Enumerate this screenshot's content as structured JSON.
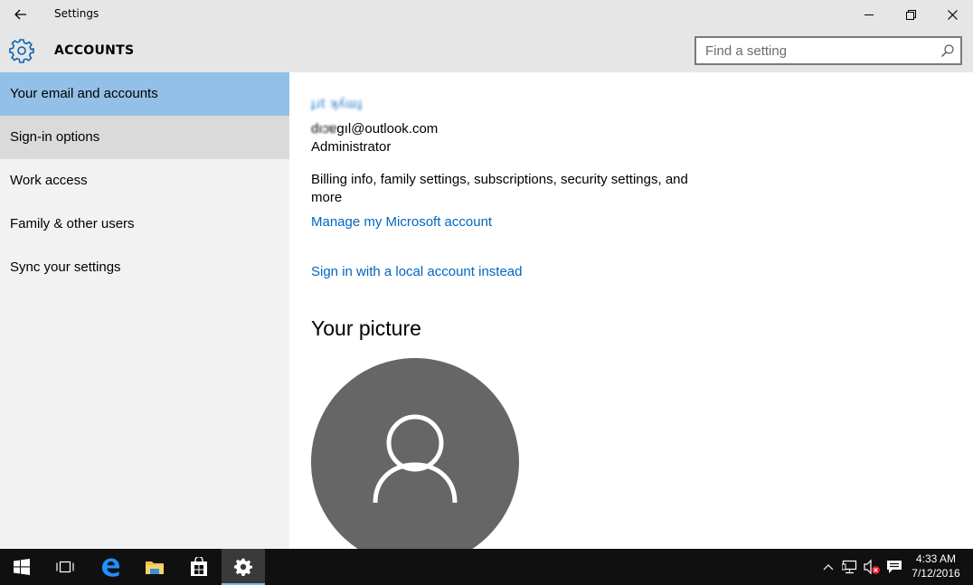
{
  "window": {
    "title": "Settings"
  },
  "header": {
    "title": "ACCOUNTS",
    "search": {
      "placeholder": "Find a setting",
      "value": ""
    }
  },
  "sidebar": {
    "items": [
      {
        "label": "Your email and accounts",
        "state": "selected"
      },
      {
        "label": "Sign-in options",
        "state": "hover"
      },
      {
        "label": "Work access",
        "state": "normal"
      },
      {
        "label": "Family & other users",
        "state": "normal"
      },
      {
        "label": "Sync your settings",
        "state": "normal"
      }
    ]
  },
  "account": {
    "name": "ɟɹt   ʞʎɯɟ",
    "email_prefix": "dıɔɐ",
    "email_suffix": "ɡıl@outlook.com",
    "role": "Administrator",
    "description": "Billing info, family settings, subscriptions, security settings, and more",
    "manage_link": "Manage my Microsoft account",
    "local_account_link": "Sign in with a local account instead"
  },
  "picture": {
    "heading": "Your picture"
  },
  "taskbar": {
    "apps": [
      "start-icon",
      "task-view-icon",
      "edge-icon",
      "file-explorer-icon",
      "store-icon",
      "settings-icon"
    ],
    "active_app": "settings-icon",
    "clock": {
      "time": "4:33 AM",
      "date": "7/12/2016"
    }
  },
  "colors": {
    "accent": "#0067c0",
    "selected_nav": "#92c0e8",
    "sidebar_bg": "#f2f2f2",
    "avatar_bg": "#666666"
  }
}
